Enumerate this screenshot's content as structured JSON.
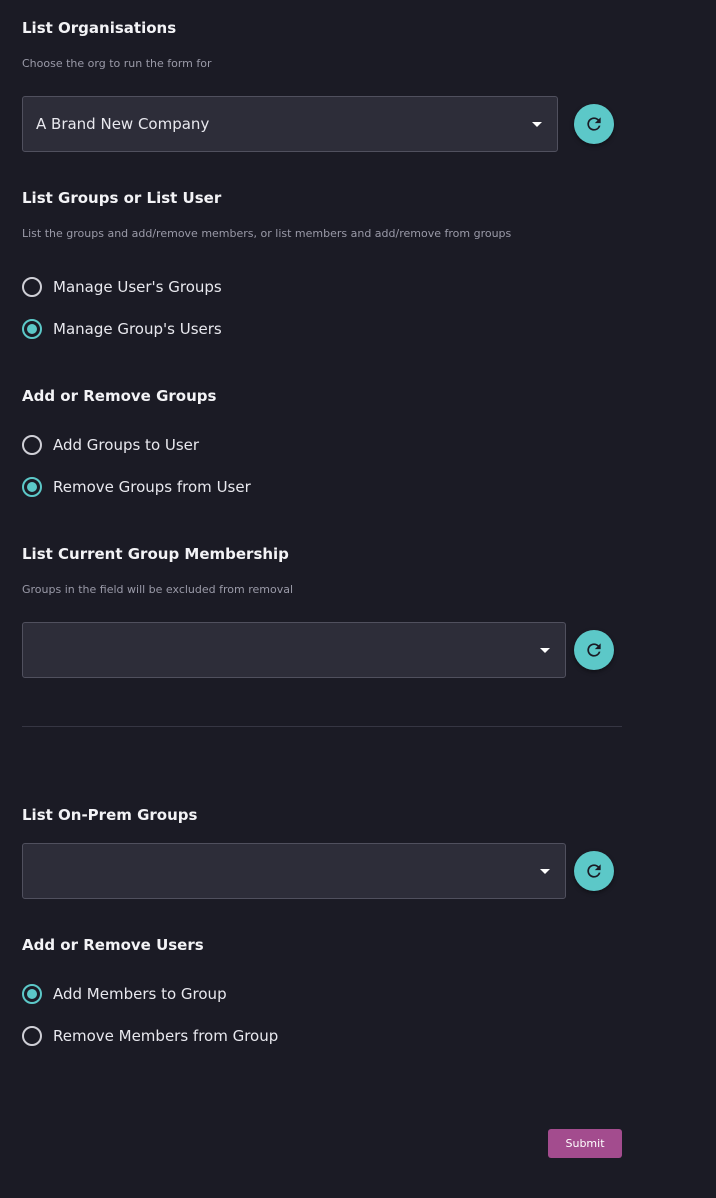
{
  "sections": {
    "organisations": {
      "title": "List Organisations",
      "help": "Choose the org to run the form for",
      "selected": "A Brand New Company"
    },
    "groups_or_user": {
      "title": "List Groups or List User",
      "help": "List the groups and add/remove members, or list members and add/remove from groups",
      "options": [
        "Manage User's Groups",
        "Manage Group's Users"
      ],
      "selected_index": 1
    },
    "add_remove_groups": {
      "title": "Add or Remove Groups",
      "options": [
        "Add Groups to User",
        "Remove Groups from User"
      ],
      "selected_index": 1
    },
    "current_membership": {
      "title": "List Current Group Membership",
      "help": "Groups in the field will be excluded from removal",
      "selected": ""
    },
    "onprem_groups": {
      "title": "List On-Prem Groups",
      "selected": ""
    },
    "add_remove_users": {
      "title": "Add or Remove Users",
      "options": [
        "Add Members to Group",
        "Remove Members from Group"
      ],
      "selected_index": 0
    }
  },
  "submit_label": "Submit",
  "icons": {
    "refresh": "refresh-icon",
    "dropdown": "chevron-down-icon"
  },
  "colors": {
    "background": "#1b1b25",
    "accent": "#5cc8c8",
    "submit": "#a34c8e",
    "field": "#2d2d39"
  }
}
